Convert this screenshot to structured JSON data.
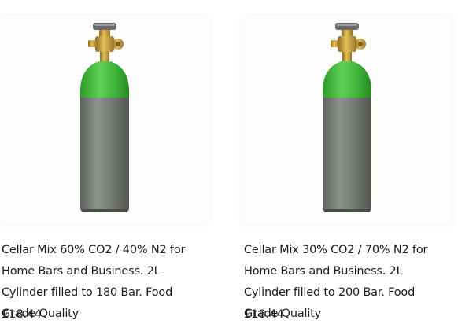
{
  "products": [
    {
      "title": "Cellar Mix 60% CO2 / 40% N2 for Home Bars and Business. 2L Cylinder filled to 180 Bar. Food Grade Quality",
      "price": "£18.44",
      "image_icon": "gas-cylinder-icon"
    },
    {
      "title": "Cellar Mix 30% CO2 / 70% N2 for Home Bars and Business. 2L Cylinder filled to 200 Bar. Food Grade Quality",
      "price": "£18.44",
      "image_icon": "gas-cylinder-icon"
    }
  ],
  "colors": {
    "cylinder_body": "#7a7e78",
    "cylinder_shoulder": "#3fb53a",
    "valve_brass": "#c9a23a",
    "handwheel": "#5a5a5a"
  }
}
